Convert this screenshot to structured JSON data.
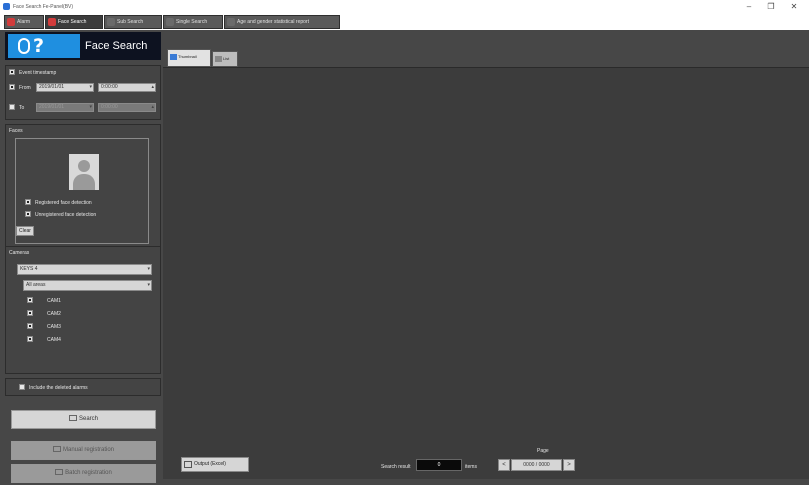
{
  "window": {
    "title": "Face Search Fe-Panel(BV)",
    "controls": [
      "minimize",
      "maximize",
      "close"
    ],
    "control_glyphs": [
      "–",
      "❐",
      "✕"
    ]
  },
  "app_tabs": [
    {
      "label": "Alarm",
      "icon": "alarm-icon",
      "color": "#d23c3c",
      "active": false
    },
    {
      "label": "Face Search",
      "icon": "face-search-icon",
      "color": "#d23c3c",
      "active": true
    },
    {
      "label": "Sub Search",
      "icon": "sub-search-icon",
      "color": "#6a6a6a",
      "active": false
    },
    {
      "label": "Single Search",
      "icon": "single-search-icon",
      "color": "#6a6a6a",
      "active": false
    },
    {
      "label": "Age and gender statistical report",
      "icon": "report-icon",
      "color": "#6a6a6a",
      "active": false
    }
  ],
  "header": {
    "title": "Face Search",
    "logo": "face-search-logo"
  },
  "time_panel": {
    "event_timestamp": {
      "label": "Event timestamp",
      "checked": true
    },
    "from": {
      "label": "From",
      "checked": true,
      "date": "2019/01/01",
      "time": "0:00:00"
    },
    "to": {
      "label": "To",
      "checked": false,
      "date": "2019/01/01",
      "time": "0:00:00"
    }
  },
  "faces_panel": {
    "title": "Faces",
    "registered": {
      "label": "Registered face detection",
      "checked": true
    },
    "unregistered": {
      "label": "Unregistered face detection",
      "checked": true
    },
    "clear_label": "Clear"
  },
  "cameras_panel": {
    "title": "Cameras",
    "group": "KEYS 4",
    "area": "All areas",
    "cameras": [
      {
        "name": "CAM1",
        "checked": true
      },
      {
        "name": "CAM2",
        "checked": true
      },
      {
        "name": "CAM3",
        "checked": true
      },
      {
        "name": "CAM4",
        "checked": true
      }
    ]
  },
  "include_deleted": {
    "label": "Include the deleted alarms",
    "checked": false
  },
  "buttons": {
    "search": "Search",
    "manual_registration": "Manual registration",
    "batch_registration": "Batch registration"
  },
  "view_tabs": [
    {
      "label": "Thumbnail",
      "active": true
    },
    {
      "label": "List",
      "active": false
    }
  ],
  "footer": {
    "output_label": "Output (Excel)",
    "search_result_label": "Search result",
    "result_count": "0",
    "result_unit": "items",
    "page_label": "Page",
    "page_value": "0000 / 0000",
    "prev": "<",
    "next": ">"
  },
  "colors": {
    "background": "#474747",
    "results_area": "#3c3c3c",
    "accent_blue": "#1f8fe0",
    "header_dark": "#0d1220"
  }
}
